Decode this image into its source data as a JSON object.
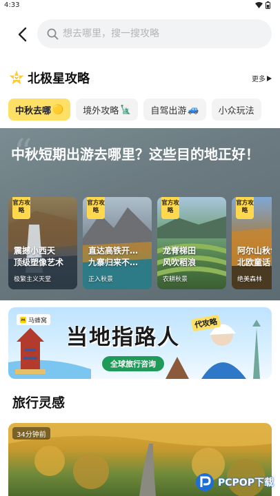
{
  "status_bar": {
    "time": "4:33"
  },
  "header": {
    "search_placeholder": "想去哪里，搜一搜攻略"
  },
  "section": {
    "title": "北极星攻略",
    "more_label": "更多"
  },
  "tabs": [
    {
      "label": "中秋去哪",
      "emoji": "🟡",
      "active": true
    },
    {
      "label": "境外攻略",
      "emoji": "🗽",
      "active": false
    },
    {
      "label": "自驾出游",
      "emoji": "🚙",
      "active": false
    },
    {
      "label": "小众玩法",
      "emoji": "",
      "active": false
    }
  ],
  "hero": {
    "title": "中秋短期出游去哪里？这些目的地正好！",
    "cards": [
      {
        "badge": "官方攻略",
        "title": "震撼小西天\n顶级塑像艺术",
        "subtitle": "极繁主义天堂"
      },
      {
        "badge": "官方攻略",
        "title": "直达高铁开…\n九寨归来不…",
        "subtitle": "正入秋景"
      },
      {
        "badge": "官方攻略",
        "title": "龙脊梯田\n风吹稻浪",
        "subtitle": "农耕秋景"
      },
      {
        "badge": "官方攻略",
        "title": "阿尔山秋色\n北欧童话",
        "subtitle": "绝美森林"
      }
    ]
  },
  "banner": {
    "brand": "马蜂窝",
    "title": "当地指路人",
    "tag": "代攻略",
    "button": "全球旅行咨询"
  },
  "inspiration": {
    "title": "旅行灵感",
    "feed": [
      {
        "time_ago": "34分钟前"
      }
    ]
  },
  "watermark": {
    "text": "PCPOP下载"
  },
  "colors": {
    "accent_yellow": "#ffe066",
    "banner_green": "#1f9a58"
  }
}
